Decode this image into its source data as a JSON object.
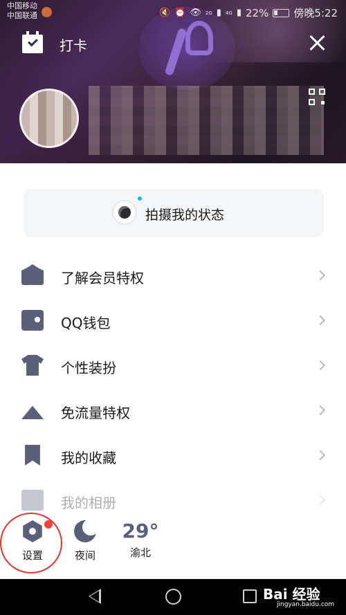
{
  "status_bar": {
    "carrier_1": "中国移动",
    "carrier_2": "中国联通",
    "battery": "22%",
    "time": "傍晚5:22",
    "net_1": "2G",
    "net_2": "4G"
  },
  "header": {
    "checkin_label": "打卡"
  },
  "status_card": {
    "label": "拍摄我的状态"
  },
  "menu": [
    {
      "label": "了解会员特权",
      "icon": "vip-crown-icon"
    },
    {
      "label": "QQ钱包",
      "icon": "wallet-icon"
    },
    {
      "label": "个性装扮",
      "icon": "shirt-icon"
    },
    {
      "label": "免流量特权",
      "icon": "signal-tower-icon"
    },
    {
      "label": "我的收藏",
      "icon": "bookmark-icon"
    },
    {
      "label": "我的相册",
      "icon": "photo-icon"
    }
  ],
  "bottom": {
    "settings_label": "设置",
    "night_label": "夜间",
    "temperature": "29°",
    "location": "渝北"
  },
  "watermark": {
    "brand": "Bai 经验",
    "url": "jingyan.baidu.com"
  },
  "colors": {
    "icon": "#5a5f7a",
    "badge": "#f0443c",
    "highlight": "#e0342c",
    "accent_dot": "#18b6f2"
  }
}
